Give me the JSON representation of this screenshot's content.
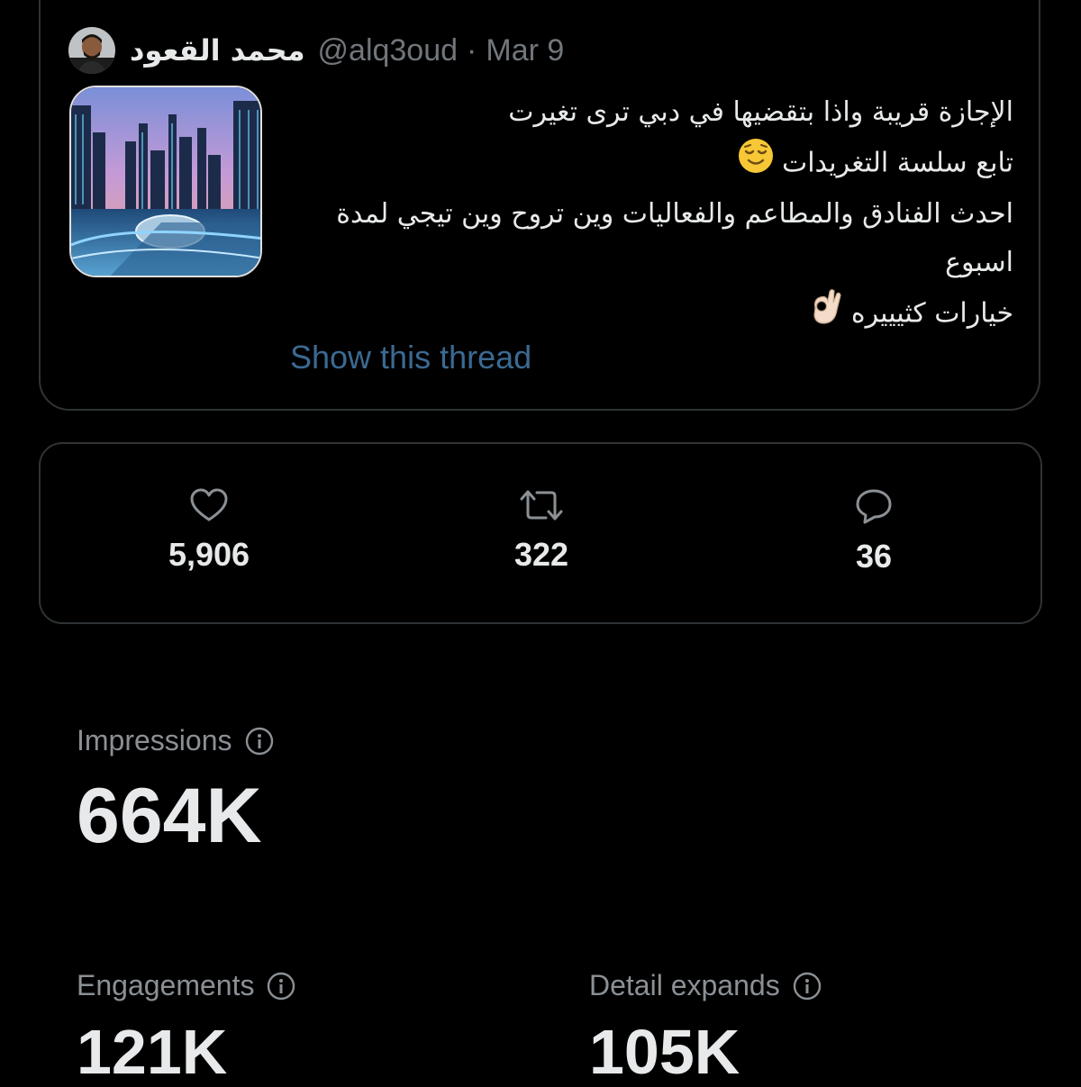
{
  "tweet": {
    "author": {
      "display_name": "محمد القعود",
      "handle": "@alq3oud"
    },
    "separator": "·",
    "date": "Mar 9",
    "text_lines": [
      "الإجازة قريبة واذا بتقضيها في دبي ترى تغيرت",
      "تابع سلسة التغريدات",
      "احدث الفنادق والمطاعم والفعاليات وين تروح وين تيجي لمدة",
      "اسبوع",
      "خيارات كثيييره"
    ],
    "emojis": [
      "relieved-face",
      "ok-hand"
    ],
    "show_thread": "Show this thread"
  },
  "stats": {
    "likes": "5,906",
    "retweets": "322",
    "replies": "36"
  },
  "metrics": {
    "impressions": {
      "label": "Impressions",
      "value": "664K"
    },
    "engagements": {
      "label": "Engagements",
      "value": "121K"
    },
    "detail_expands": {
      "label": "Detail expands",
      "value": "105K"
    }
  },
  "colors": {
    "background": "#000000",
    "border": "#2f3336",
    "link": "#3b6a92",
    "secondary_text": "#71767b"
  }
}
